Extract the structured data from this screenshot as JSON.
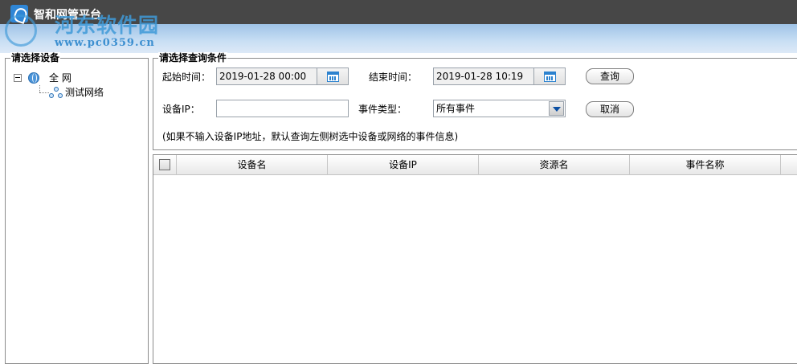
{
  "app": {
    "title": "智和网管平台",
    "watermark_text": "河东软件园",
    "watermark_url": "www.pc0359.cn"
  },
  "left_panel": {
    "legend": "请选择设备",
    "tree": [
      {
        "label": "全  网",
        "icon": "globe-icon",
        "expanded": true
      },
      {
        "label": "测试网络",
        "icon": "network-icon"
      }
    ]
  },
  "query": {
    "legend": "请选择查询条件",
    "start_label": "起始时间：",
    "start_value": "2019-01-28 00:00",
    "end_label": "结束时间：",
    "end_value": "2019-01-28 10:19",
    "query_button": "查询",
    "ip_label": "设备IP：",
    "ip_value": "",
    "event_type_label": "事件类型：",
    "event_type_value": "所有事件",
    "cancel_button": "取消",
    "hint": "(如果不输入设备IP地址，默认查询左侧树选中设备或网络的事件信息)"
  },
  "grid": {
    "columns": [
      "设备名",
      "设备IP",
      "资源名",
      "事件名称"
    ]
  },
  "colors": {
    "titlebar": "#474747",
    "accent_blue": "#2c82cf",
    "band_top": "#9fc3e7"
  }
}
